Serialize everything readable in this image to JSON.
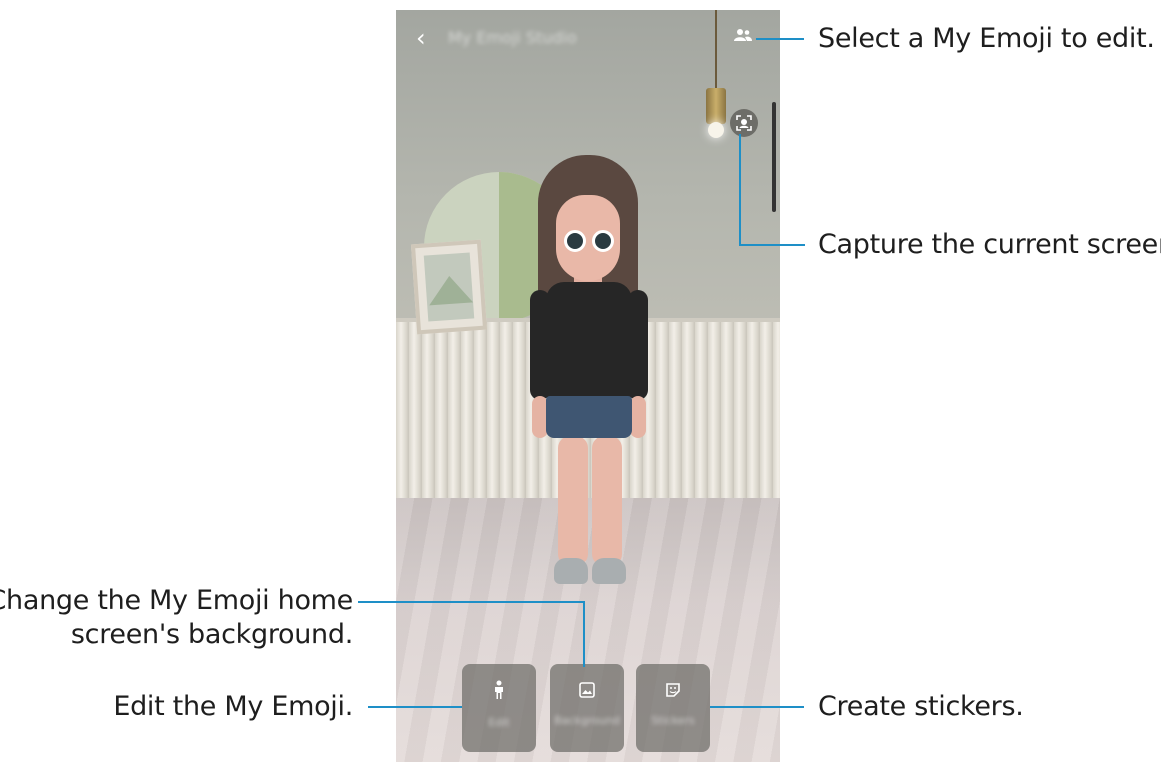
{
  "callouts": {
    "select_emoji": "Select a My Emoji to edit.",
    "capture": "Capture the current screen.",
    "change_background_line1": "Change the My Emoji home",
    "change_background_line2": "screen's background.",
    "edit_emoji": "Edit the My Emoji.",
    "create_stickers": "Create stickers."
  },
  "screen": {
    "back_icon": "chevron-left-icon",
    "title": "My Emoji Studio",
    "select_icon": "people-icon",
    "capture_icon": "face-capture-icon",
    "buttons": [
      {
        "label": "Edit",
        "icon": "person-icon"
      },
      {
        "label": "Background",
        "icon": "image-icon"
      },
      {
        "label": "Stickers",
        "icon": "sticker-icon"
      }
    ]
  },
  "colors": {
    "callout_line": "#1e8fc7",
    "callout_text": "#1e1e1e"
  }
}
